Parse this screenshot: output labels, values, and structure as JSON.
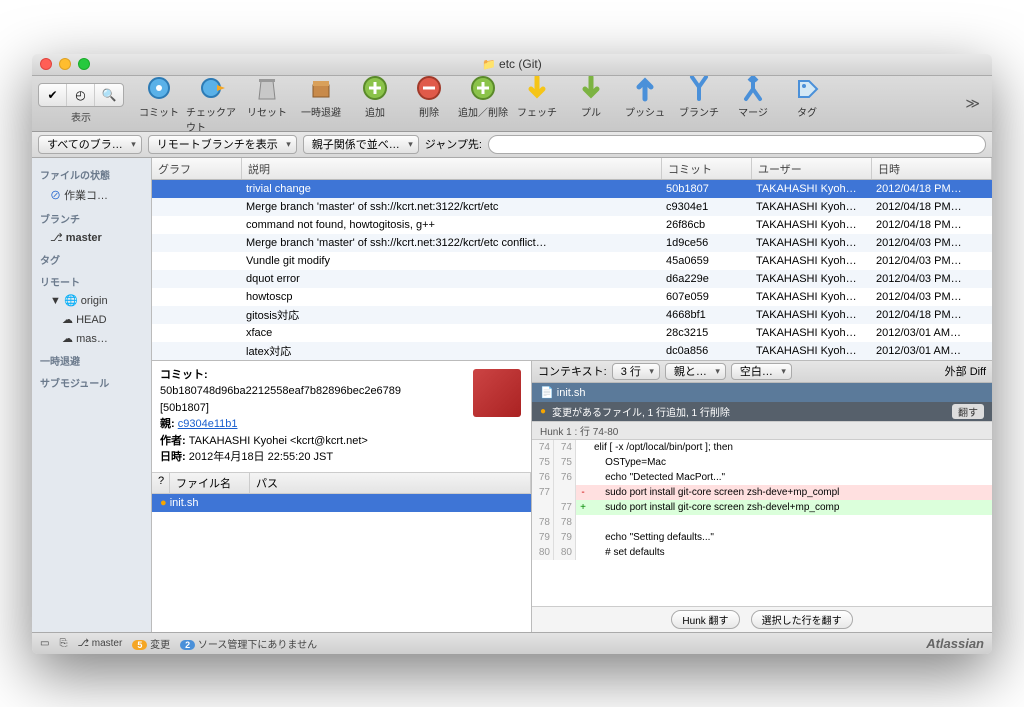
{
  "title": "etc (Git)",
  "toolbar": {
    "view_label": "表示",
    "buttons": [
      {
        "label": "コミット",
        "icon": "commit"
      },
      {
        "label": "チェックアウト",
        "icon": "checkout"
      },
      {
        "label": "リセット",
        "icon": "reset"
      },
      {
        "label": "一時退避",
        "icon": "stash"
      },
      {
        "label": "追加",
        "icon": "add"
      },
      {
        "label": "削除",
        "icon": "remove"
      },
      {
        "label": "追加／削除",
        "icon": "addremove"
      },
      {
        "label": "フェッチ",
        "icon": "fetch"
      },
      {
        "label": "プル",
        "icon": "pull"
      },
      {
        "label": "プッシュ",
        "icon": "push"
      },
      {
        "label": "ブランチ",
        "icon": "branch"
      },
      {
        "label": "マージ",
        "icon": "merge"
      },
      {
        "label": "タグ",
        "icon": "tag"
      }
    ]
  },
  "filter": {
    "flt1": "すべてのブラ…",
    "flt2": "リモートブランチを表示",
    "flt3": "親子関係で並べ…",
    "jump": "ジャンプ先:"
  },
  "sidebar": {
    "file_state": "ファイルの状態",
    "working": "作業コ…",
    "branches": "ブランチ",
    "master": "master",
    "tags": "タグ",
    "remotes": "リモート",
    "origin": "origin",
    "head": "HEAD",
    "mas": "mas…",
    "stash": "一時退避",
    "submod": "サブモジュール"
  },
  "columns": {
    "graph": "グラフ",
    "desc": "説明",
    "commit": "コミット",
    "user": "ユーザー",
    "date": "日時"
  },
  "commits": [
    {
      "desc": "trivial change",
      "sha": "50b1807",
      "user": "TAKAHASHI Kyoh…",
      "date": "2012/04/18 PM…",
      "sel": true
    },
    {
      "desc": "Merge branch 'master' of ssh://kcrt.net:3122/kcrt/etc",
      "sha": "c9304e1",
      "user": "TAKAHASHI Kyoh…",
      "date": "2012/04/18 PM…"
    },
    {
      "desc": "command not found, howtogitosis, g++",
      "sha": "26f86cb",
      "user": "TAKAHASHI Kyoh…",
      "date": "2012/04/18 PM…"
    },
    {
      "desc": "Merge branch 'master' of ssh://kcrt.net:3122/kcrt/etc conflict…",
      "sha": "1d9ce56",
      "user": "TAKAHASHI Kyoh…",
      "date": "2012/04/03 PM…"
    },
    {
      "desc": "Vundle git modify",
      "sha": "45a0659",
      "user": "TAKAHASHI Kyoh…",
      "date": "2012/04/03 PM…"
    },
    {
      "desc": "dquot error",
      "sha": "d6a229e",
      "user": "TAKAHASHI Kyoh…",
      "date": "2012/04/03 PM…"
    },
    {
      "desc": "howtoscp",
      "sha": "607e059",
      "user": "TAKAHASHI Kyoh…",
      "date": "2012/04/03 PM…"
    },
    {
      "desc": "gitosis対応",
      "sha": "4668bf1",
      "user": "TAKAHASHI Kyoh…",
      "date": "2012/04/18 PM…"
    },
    {
      "desc": "xface",
      "sha": "28c3215",
      "user": "TAKAHASHI Kyoh…",
      "date": "2012/03/01 AM…"
    },
    {
      "desc": "latex対応",
      "sha": "dc0a856",
      "user": "TAKAHASHI Kyoh…",
      "date": "2012/03/01 AM…"
    }
  ],
  "detail": {
    "commit_lbl": "コミット:",
    "full_sha": "50b180748d96ba2212558eaf7b82896bec2e6789",
    "short": "[50b1807]",
    "parent_lbl": "親:",
    "parent_sha": "c9304e11b1",
    "author_lbl": "作者:",
    "author": "TAKAHASHI Kyohei <kcrt@kcrt.net>",
    "date_lbl": "日時:",
    "date": "2012年4月18日 22:55:20 JST",
    "file_q": "?",
    "file_name": "ファイル名",
    "file_path": "パス",
    "file": "init.sh"
  },
  "diff": {
    "context_lbl": "コンテキスト:",
    "context_val": "3 行",
    "opt1": "親と…",
    "opt2": "空白…",
    "ext": "外部 Diff",
    "file": "init.sh",
    "status": "変更があるファイル, 1 行追加, 1 行削除",
    "revert_btn": "翻す",
    "hunk": "Hunk 1 : 行 74-80",
    "lines": [
      {
        "a": "74",
        "b": "74",
        "t": "elif [ -x /opt/local/bin/port ]; then"
      },
      {
        "a": "75",
        "b": "75",
        "t": "    OSType=Mac"
      },
      {
        "a": "76",
        "b": "76",
        "t": "    echo \"Detected MacPort...\""
      },
      {
        "a": "77",
        "b": "",
        "m": "-",
        "t": "    sudo port install git-core screen zsh-deve+mp_compl",
        "cls": "del"
      },
      {
        "a": "",
        "b": "77",
        "m": "+",
        "t": "    sudo port install git-core screen zsh-devel+mp_comp",
        "cls": "add"
      },
      {
        "a": "78",
        "b": "78",
        "t": ""
      },
      {
        "a": "79",
        "b": "79",
        "t": "    echo \"Setting defaults...\""
      },
      {
        "a": "80",
        "b": "80",
        "t": "    # set defaults"
      }
    ],
    "hunk_revert": "Hunk 翻す",
    "sel_revert": "選択した行を翻す"
  },
  "status": {
    "branch": "master",
    "changes_n": "5",
    "changes": "変更",
    "warn_n": "2",
    "warn": "ソース管理下にありません",
    "brand": "Atlassian"
  }
}
